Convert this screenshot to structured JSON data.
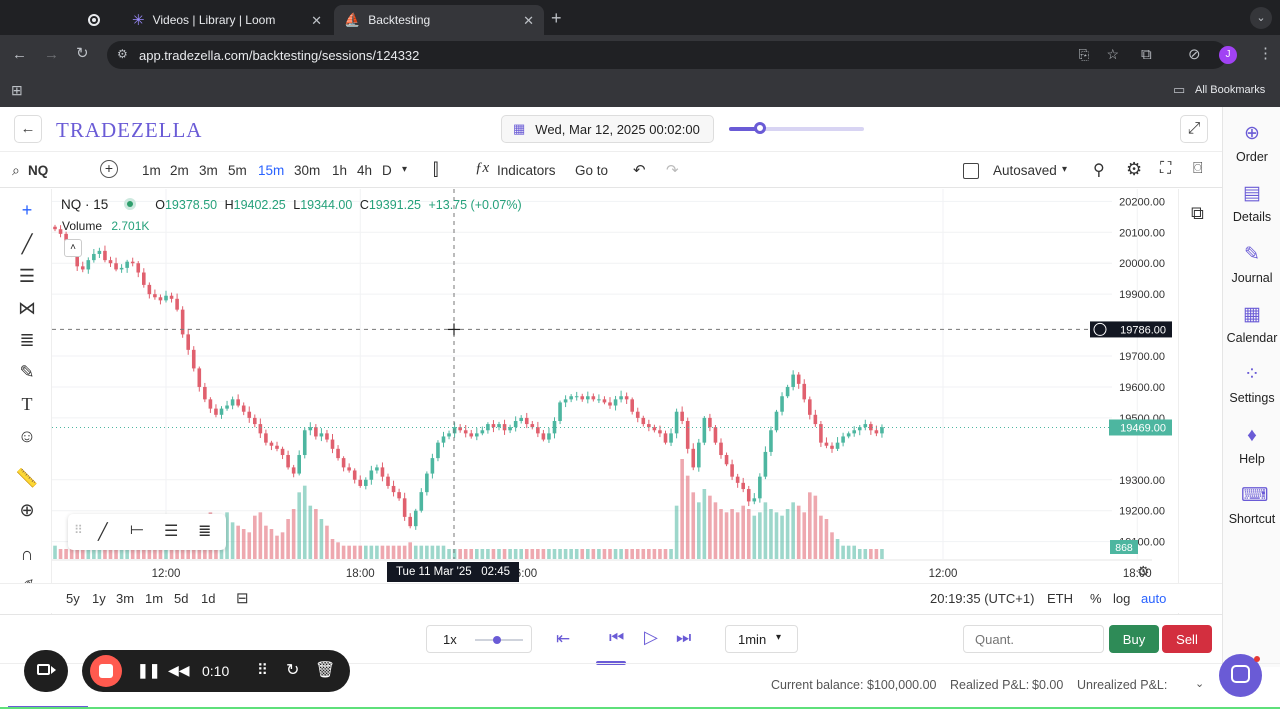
{
  "browser": {
    "tabs": [
      {
        "label": ""
      },
      {
        "label": "Videos | Library | Loom"
      },
      {
        "label": "Backtesting"
      }
    ],
    "url": "app.tradezella.com/backtesting/sessions/124332",
    "bookmarks_label": "All Bookmarks",
    "profile_initial": "J"
  },
  "header": {
    "logo": "TRADEZELLA",
    "date_display": "Wed, Mar 12, 2025 00:02:00",
    "slider_fraction": 0.23
  },
  "toolbar": {
    "symbol": "NQ",
    "timeframes": [
      "1m",
      "2m",
      "3m",
      "5m",
      "15m",
      "30m",
      "1h",
      "4h",
      "D"
    ],
    "active_timeframe": "15m",
    "indicators_label": "Indicators",
    "goto_label": "Go to",
    "autosave_label": "Autosaved"
  },
  "legend": {
    "symbol_tf": "NQ · 15",
    "o_label": "O",
    "o": "19378.50",
    "h_label": "H",
    "h": "19402.25",
    "l_label": "L",
    "l": "19344.00",
    "c_label": "C",
    "c": "19391.25",
    "change": "+13.75 (+0.07%)",
    "volume_label": "Volume",
    "volume_value": "2.701K"
  },
  "chart_data": {
    "type": "candlestick",
    "price_ticks": [
      "20200.00",
      "20100.00",
      "20000.00",
      "19900.00",
      "19700.00",
      "19600.00",
      "19500.00",
      "19300.00",
      "19200.00",
      "19100.00"
    ],
    "price_tick_values": [
      20200,
      20100,
      20000,
      19900,
      19700,
      19600,
      19500,
      19300,
      19200,
      19100
    ],
    "crosshair_price": "19786.00",
    "crosshair_price_value": 19786,
    "last_price": "19469.00",
    "last_price_value": 19469,
    "volume_last": "868",
    "ylim": [
      19060,
      20240
    ],
    "time_ticks": [
      "12:00",
      "18:00",
      "12:00",
      "18:00",
      "12",
      "06:00"
    ],
    "time_tick_bars": [
      20,
      55,
      160,
      195,
      225,
      280
    ],
    "crosshair_time": "Tue 11 Mar '25   02:45",
    "partial_tick": "6:00",
    "closes": [
      20110,
      20095,
      20060,
      20030,
      19990,
      19980,
      20010,
      20030,
      20040,
      20010,
      20000,
      19980,
      19985,
      20005,
      20000,
      19970,
      19930,
      19900,
      19890,
      19880,
      19895,
      19885,
      19850,
      19770,
      19720,
      19660,
      19600,
      19560,
      19530,
      19510,
      19530,
      19540,
      19560,
      19540,
      19520,
      19500,
      19480,
      19450,
      19420,
      19410,
      19400,
      19380,
      19340,
      19320,
      19380,
      19460,
      19470,
      19440,
      19450,
      19430,
      19400,
      19370,
      19340,
      19330,
      19300,
      19280,
      19300,
      19330,
      19340,
      19310,
      19280,
      19260,
      19240,
      19180,
      19150,
      19200,
      19260,
      19320,
      19370,
      19420,
      19440,
      19450,
      19470,
      19460,
      19450,
      19440,
      19450,
      19460,
      19480,
      19470,
      19480,
      19460,
      19470,
      19490,
      19500,
      19480,
      19470,
      19450,
      19430,
      19450,
      19490,
      19550,
      19560,
      19570,
      19570,
      19560,
      19570,
      19560,
      19560,
      19550,
      19540,
      19560,
      19570,
      19560,
      19520,
      19500,
      19480,
      19470,
      19460,
      19450,
      19420,
      19450,
      19520,
      19490,
      19400,
      19340,
      19420,
      19500,
      19470,
      19420,
      19380,
      19350,
      19310,
      19290,
      19270,
      19230,
      19240,
      19310,
      19390,
      19460,
      19520,
      19570,
      19600,
      19640,
      19610,
      19560,
      19510,
      19480,
      19420,
      19410,
      19400,
      19420,
      19440,
      19450,
      19460,
      19470,
      19480,
      19460,
      19450,
      19470
    ],
    "volumes": [
      40,
      30,
      30,
      30,
      30,
      30,
      30,
      30,
      30,
      30,
      30,
      30,
      30,
      30,
      30,
      30,
      30,
      30,
      30,
      30,
      30,
      30,
      30,
      30,
      30,
      40,
      80,
      120,
      140,
      130,
      120,
      140,
      110,
      100,
      90,
      80,
      130,
      140,
      100,
      90,
      70,
      80,
      120,
      150,
      200,
      220,
      160,
      150,
      120,
      100,
      60,
      50,
      40,
      40,
      40,
      40,
      40,
      40,
      40,
      40,
      40,
      40,
      40,
      40,
      50,
      40,
      40,
      40,
      40,
      40,
      40,
      30,
      30,
      30,
      30,
      30,
      30,
      30,
      30,
      30,
      30,
      30,
      30,
      30,
      30,
      30,
      30,
      30,
      30,
      30,
      30,
      30,
      30,
      30,
      30,
      30,
      30,
      30,
      30,
      30,
      30,
      30,
      30,
      30,
      30,
      30,
      30,
      30,
      30,
      30,
      30,
      30,
      160,
      300,
      250,
      200,
      170,
      210,
      190,
      170,
      150,
      140,
      150,
      140,
      160,
      150,
      130,
      140,
      170,
      150,
      140,
      130,
      150,
      170,
      160,
      140,
      200,
      190,
      130,
      120,
      80,
      60,
      40,
      40,
      40,
      30,
      30,
      30,
      30,
      30,
      30,
      30,
      30
    ],
    "up_color": "#4db6a0",
    "down_color": "#e0606e"
  },
  "ranges": {
    "items": [
      "5y",
      "1y",
      "3m",
      "1m",
      "5d",
      "1d"
    ],
    "clock": "20:19:35 (UTC+1)",
    "session": "ETH",
    "pct": "%",
    "log": "log",
    "auto": "auto"
  },
  "playback": {
    "speed": "1x",
    "speed_fraction": 0.45,
    "interval": "1min",
    "quant_placeholder": "Quant.",
    "buy": "Buy",
    "sell": "Sell"
  },
  "status": {
    "balance_label": "Current balance:",
    "balance": "$100,000.00",
    "realized_label": "Realized P&L:",
    "realized": "$0.00",
    "unrealized_label": "Unrealized P&L:"
  },
  "sidebar": {
    "items": [
      "Order",
      "Details",
      "Journal",
      "Calendar",
      "Settings",
      "Help",
      "Shortcut"
    ]
  },
  "loom": {
    "time": "0:10"
  },
  "colors": {
    "accent": "#6a5bd6",
    "brand": "#6a5bd6",
    "buy": "#2e8b57",
    "sell": "#d32f3f",
    "active_tf": "#2962ff"
  }
}
